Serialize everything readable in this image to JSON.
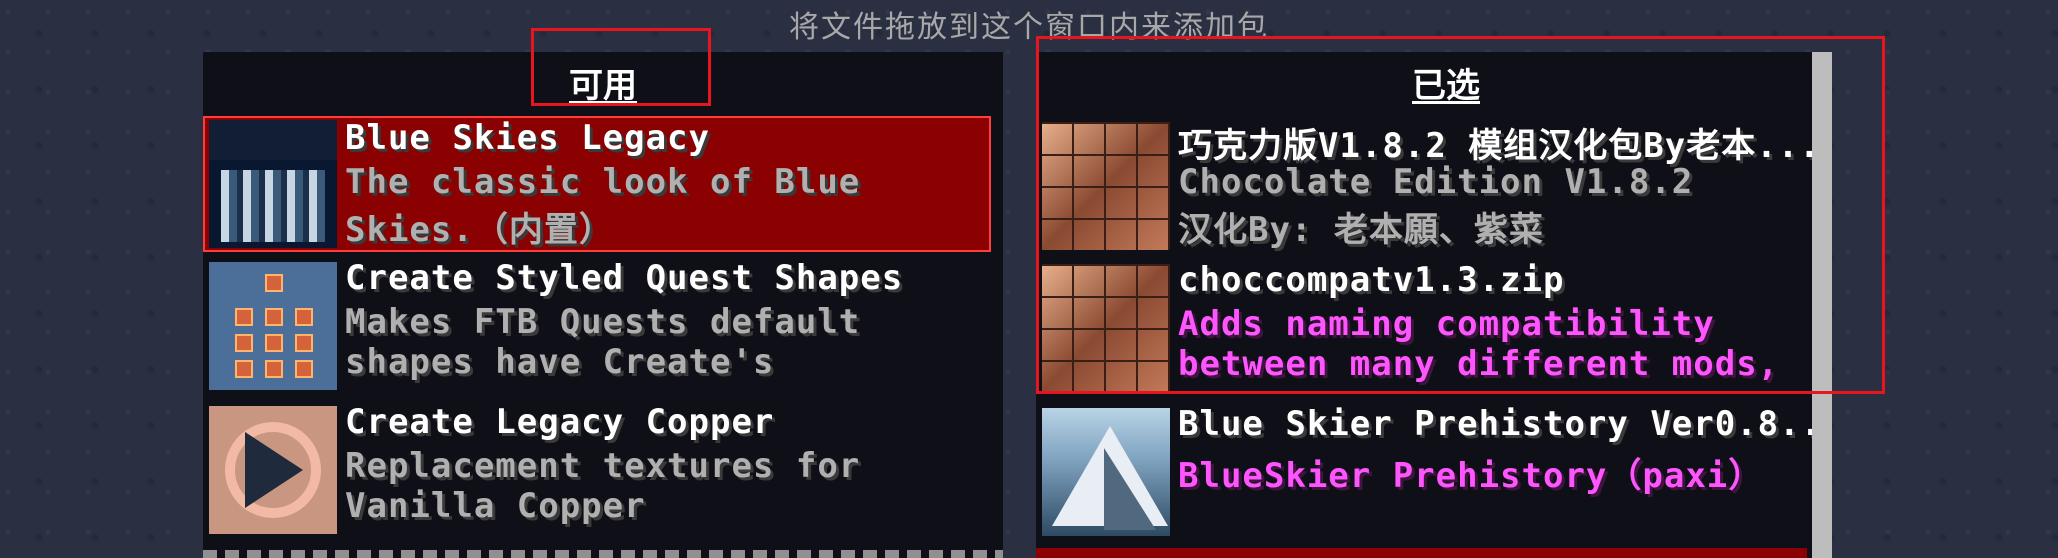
{
  "hint": "将文件拖放到这个窗口内来添加包",
  "available": {
    "title": "可用",
    "packs": [
      {
        "name": "Blue Skies Legacy",
        "desc1": "The classic look of Blue",
        "desc2": "Skies.（内置）",
        "thumb": "blue-skies-tower"
      },
      {
        "name": "Create Styled Quest Shapes",
        "desc1": "Makes FTB Quests default",
        "desc2": "shapes have Create's",
        "thumb": "quest-shapes-grid"
      },
      {
        "name": "Create Legacy Copper",
        "desc1": "Replacement textures for",
        "desc2": "Vanilla Copper",
        "thumb": "copper-play-icon"
      }
    ]
  },
  "selected": {
    "title": "已选",
    "packs": [
      {
        "name": "巧克力版V1.8.2 模组汉化包By老本...",
        "desc1": "Chocolate Edition V1.8.2",
        "desc2": "汉化By: 老本願、紫菜",
        "thumb": "chocolate-blocks"
      },
      {
        "name": "choccompatv1.3.zip",
        "desc1": "Adds naming compatibility",
        "desc2": "between many different mods,",
        "thumb": "chocolate-blocks"
      },
      {
        "name": "Blue Skier Prehistory Ver0.8...",
        "desc1": "BlueSkier Prehistory（paxi）",
        "desc2": "",
        "thumb": "mountain-peak"
      }
    ]
  },
  "colors": {
    "selected_bg": "#8b0000",
    "accent_pink": "#ff55ff",
    "annotation": "#e8141e"
  }
}
